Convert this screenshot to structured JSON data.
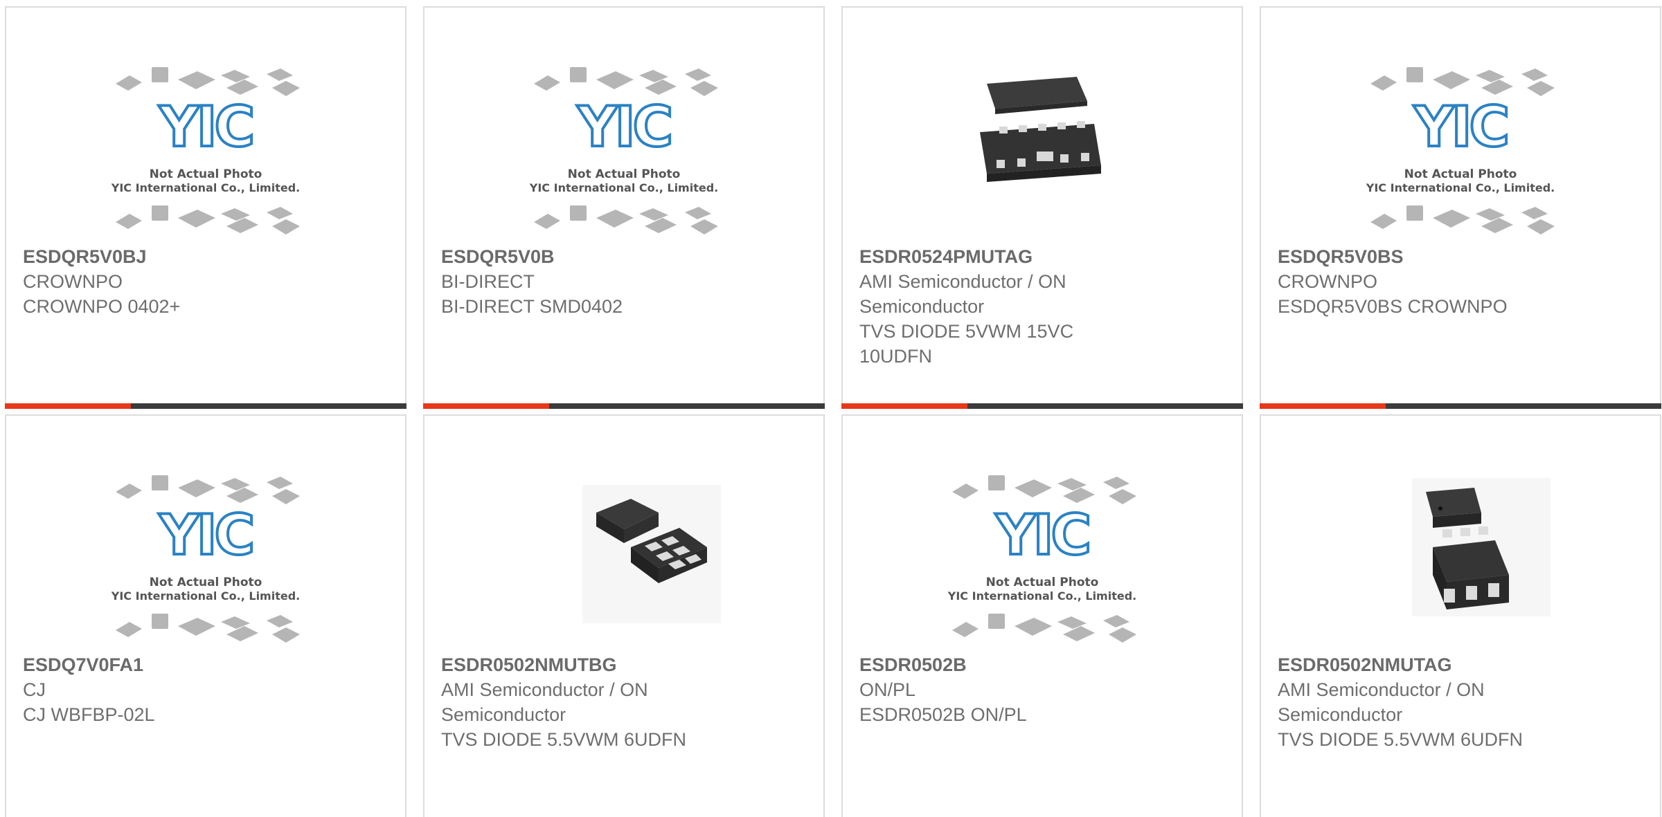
{
  "colors": {
    "accent": "#e8381a",
    "bar": "#3b3b3b",
    "border": "#dcdcdc",
    "logo": "#2a82c4"
  },
  "placeholder": {
    "logo_text": "YIC",
    "line1": "Not Actual Photo",
    "line2": "YIC International Co., Limited."
  },
  "products": [
    {
      "part": "ESDQR5V0BJ",
      "lines": [
        "CROWNPO",
        "CROWNPO 0402+"
      ],
      "image": "placeholder"
    },
    {
      "part": "ESDQR5V0B",
      "lines": [
        "BI-DIRECT",
        "BI-DIRECT SMD0402"
      ],
      "image": "placeholder"
    },
    {
      "part": "ESDR0524PMUTAG",
      "lines": [
        "AMI Semiconductor / ON",
        "Semiconductor",
        "TVS DIODE 5VWM 15VC",
        "10UDFN"
      ],
      "image": "udfn10"
    },
    {
      "part": "ESDQR5V0BS",
      "lines": [
        "CROWNPO",
        "ESDQR5V0BS CROWNPO"
      ],
      "image": "placeholder"
    },
    {
      "part": "ESDQ7V0FA1",
      "lines": [
        "CJ",
        "CJ WBFBP-02L"
      ],
      "image": "placeholder"
    },
    {
      "part": "ESDR0502NMUTBG",
      "lines": [
        "AMI Semiconductor / ON",
        "Semiconductor",
        "TVS DIODE 5.5VWM 6UDFN"
      ],
      "image": "udfn6-flat"
    },
    {
      "part": "ESDR0502B",
      "lines": [
        "ON/PL",
        "ESDR0502B ON/PL"
      ],
      "image": "placeholder"
    },
    {
      "part": "ESDR0502NMUTAG",
      "lines": [
        "AMI Semiconductor / ON",
        "Semiconductor",
        "TVS DIODE 5.5VWM 6UDFN"
      ],
      "image": "udfn6-tall"
    }
  ]
}
